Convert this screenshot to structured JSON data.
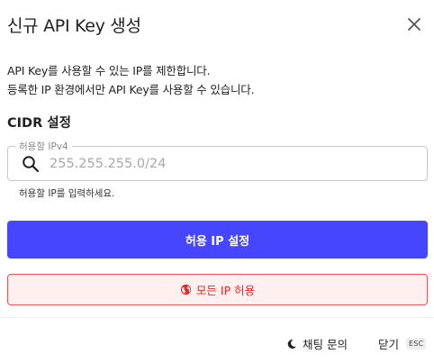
{
  "dialog": {
    "title": "신규 API Key 생성",
    "description_line1": "API Key를 사용할 수 있는 IP를 제한합니다.",
    "description_line2": "등록한 IP 환경에서만 API Key를 사용할 수 있습니다."
  },
  "cidr": {
    "section_title": "CIDR 설정",
    "field_label": "허용할 IPv4",
    "placeholder": "255.255.255.0/24",
    "value": "",
    "helper_text": "허용할 IP를 입력하세요.",
    "search_icon": "search-icon"
  },
  "actions": {
    "primary_label": "허용 IP 설정",
    "allow_all_label": "모든 IP 허용",
    "allow_all_icon": "globe-icon",
    "primary_color": "#4646ff",
    "danger_color": "#e12a2a"
  },
  "footer": {
    "chat_label": "채팅 문의",
    "chat_icon": "moon-icon",
    "close_label": "닫기",
    "close_shortcut": "ESC"
  }
}
